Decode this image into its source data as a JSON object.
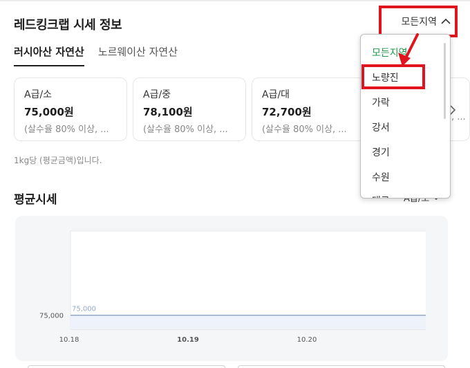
{
  "header": {
    "title": "레드킹크랩 시세 정보"
  },
  "region_select": {
    "label": "모든지역"
  },
  "tabs": [
    {
      "label": "러시아산 자연산",
      "active": true
    },
    {
      "label": "노르웨이산 자연산",
      "active": false
    }
  ],
  "cards": [
    {
      "grade": "A급/소",
      "price": "75,000원",
      "desc": "(살수율 80% 이상, ..."
    },
    {
      "grade": "A급/중",
      "price": "78,100원",
      "desc": "(살수율 80% 이상, ..."
    },
    {
      "grade": "A급/대",
      "price": "72,700원",
      "desc": "(살수율 80% 이상, ..."
    },
    {
      "grade": "",
      "price": "",
      "desc": "(살수율 80% 이상, ..."
    }
  ],
  "unit_note": "1kg당 (평균금액)입니다.",
  "section": {
    "title": "평균시세",
    "filter_label": "A급/소"
  },
  "dropdown": {
    "options": [
      {
        "label": "모든지역",
        "selected": true
      },
      {
        "label": "노량진",
        "selected": false
      },
      {
        "label": "가락",
        "selected": false
      },
      {
        "label": "강서",
        "selected": false
      },
      {
        "label": "경기",
        "selected": false
      },
      {
        "label": "수원",
        "selected": false
      },
      {
        "label": "대구",
        "selected": false
      }
    ]
  },
  "colors": {
    "accent_green": "#1c9a49",
    "annotation_red": "#e0141e",
    "line_blue": "#93a8c8"
  },
  "chart_data": {
    "type": "line",
    "categories": [
      "10.18",
      "10.19",
      "10.20"
    ],
    "series": [
      {
        "values": [
          75000,
          75000,
          75000
        ],
        "labels": [
          "75,000",
          "",
          ""
        ]
      }
    ],
    "y_ticks": [
      "75,000"
    ],
    "y_tick_values": [
      75000
    ],
    "ylim": [
      74000,
      81000
    ],
    "grid": true
  }
}
